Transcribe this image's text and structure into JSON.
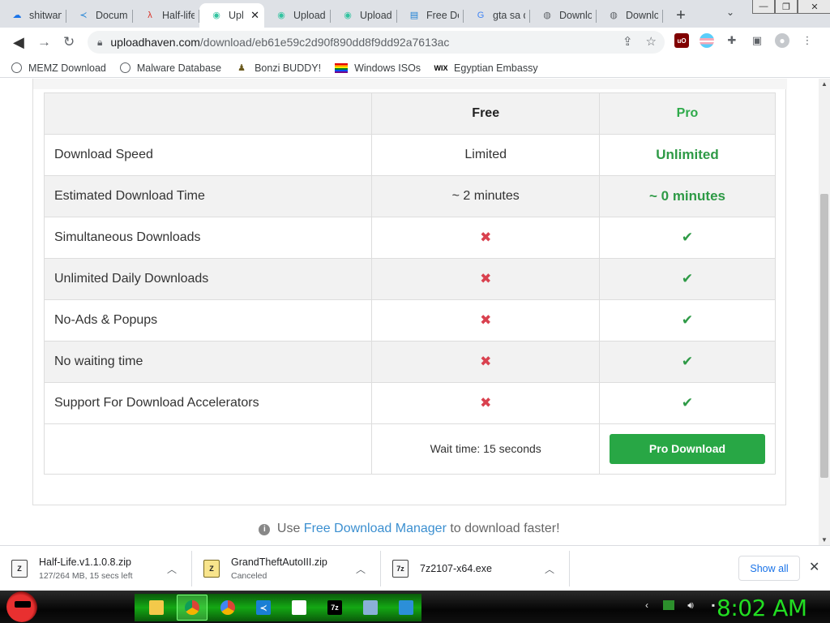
{
  "browser": {
    "tabs": [
      {
        "title": "shitwan",
        "icon": "cloud-upload-icon",
        "color": "#1a73e8",
        "active": false
      },
      {
        "title": "Docum",
        "icon": "vscode-icon",
        "color": "#1a7fd4",
        "active": false
      },
      {
        "title": "Half-life",
        "icon": "half-life-icon",
        "color": "#d93025",
        "active": false
      },
      {
        "title": "Upl",
        "icon": "uploadhaven-icon",
        "color": "#33c3a0",
        "active": true
      },
      {
        "title": "Upload",
        "icon": "uploadhaven-icon",
        "color": "#33c3a0",
        "active": false
      },
      {
        "title": "Upload",
        "icon": "uploadhaven-icon",
        "color": "#33c3a0",
        "active": false
      },
      {
        "title": "Free Do",
        "icon": "page-icon",
        "color": "#1a7fd4",
        "active": false
      },
      {
        "title": "gta sa d",
        "icon": "google-icon",
        "color": "#4285f4",
        "active": false
      },
      {
        "title": "Downlo",
        "icon": "globe-icon",
        "color": "#5f6368",
        "active": false
      },
      {
        "title": "Downlo",
        "icon": "globe-icon",
        "color": "#5f6368",
        "active": false
      }
    ],
    "url_domain": "uploadhaven.com",
    "url_path": "/download/eb61e59c2d90f890dd8f9dd92a7613ac",
    "bookmarks": [
      {
        "label": "MEMZ Download",
        "icon": "globe-icon"
      },
      {
        "label": "Malware Database",
        "icon": "globe-icon"
      },
      {
        "label": "Bonzi BUDDY!",
        "icon": "bonzi-icon"
      },
      {
        "label": "Windows ISOs",
        "icon": "rainbow-flag-icon"
      },
      {
        "label": "Egyptian Embassy",
        "icon": "wix-icon"
      }
    ]
  },
  "comparison": {
    "headers": {
      "feature": "",
      "free": "Free",
      "pro": "Pro"
    },
    "rows": [
      {
        "feature": "Download Speed",
        "free": "Limited",
        "pro": "Unlimited",
        "kind": "text"
      },
      {
        "feature": "Estimated Download Time",
        "free": "~ 2 minutes",
        "pro": "~ 0 minutes",
        "kind": "text"
      },
      {
        "feature": "Simultaneous Downloads",
        "free": "✖",
        "pro": "✔",
        "kind": "mark"
      },
      {
        "feature": "Unlimited Daily Downloads",
        "free": "✖",
        "pro": "✔",
        "kind": "mark"
      },
      {
        "feature": "No-Ads & Popups",
        "free": "✖",
        "pro": "✔",
        "kind": "mark"
      },
      {
        "feature": "No waiting time",
        "free": "✖",
        "pro": "✔",
        "kind": "mark"
      },
      {
        "feature": "Support For Download Accelerators",
        "free": "✖",
        "pro": "✔",
        "kind": "mark"
      }
    ],
    "wait_text": "Wait time: 15 seconds",
    "pro_button": "Pro Download"
  },
  "tip": {
    "prefix": "Use",
    "link": "Free Download Manager",
    "suffix": "to download faster!"
  },
  "downloads": [
    {
      "name": "Half-Life.v1.1.0.8.zip",
      "status": "127/264 MB, 15 secs left"
    },
    {
      "name": "GrandTheftAutoIII.zip",
      "status": "Canceled"
    },
    {
      "name": "7z2107-x64.exe",
      "status": ""
    }
  ],
  "show_all": "Show all",
  "taskbar": {
    "apps": [
      "file-explorer-icon",
      "chrome-icon",
      "chrome-canary-icon",
      "vscode-icon",
      "notepad-icon",
      "7zip-icon",
      "network-icon",
      "remote-desktop-icon"
    ],
    "clock": "8:02 AM"
  },
  "colors": {
    "pro_green": "#2e9a46",
    "button_green": "#28a745",
    "cross_red": "#d9414f",
    "link_blue": "#3b8fd0",
    "clock_green": "#22dd22"
  }
}
